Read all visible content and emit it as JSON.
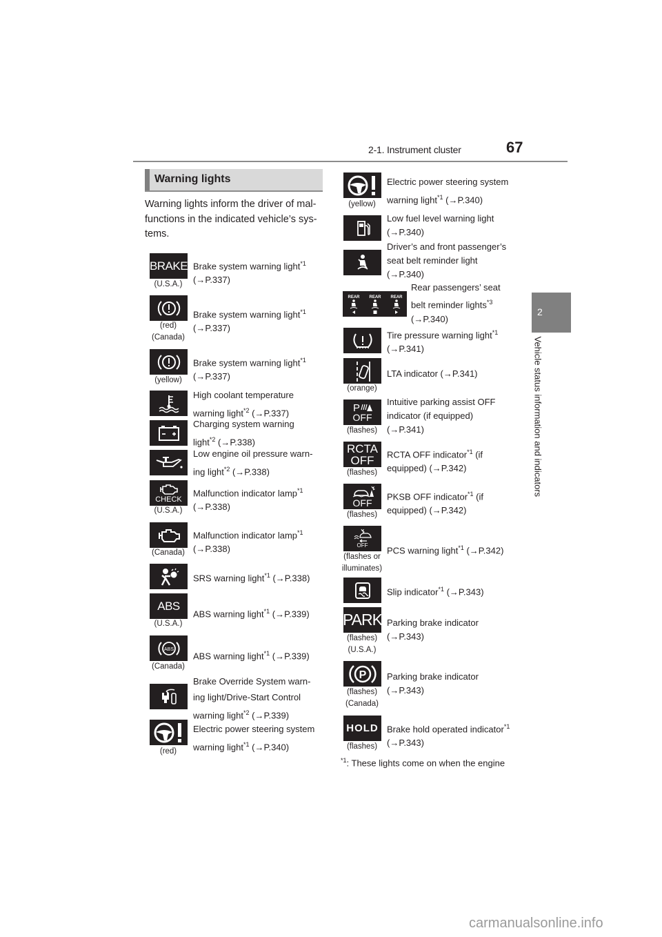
{
  "header": {
    "section": "2-1. Instrument cluster",
    "page_number": "67"
  },
  "side_tab": {
    "chapter_number": "2",
    "chapter_title": "Vehicle status information and indicators"
  },
  "section": {
    "title": "Warning lights",
    "intro_lines": [
      "Warning lights inform the driver of mal-",
      "functions in the indicated vehicle’s sys-",
      "tems."
    ]
  },
  "left_column": [
    {
      "icon": "brake-text-icon",
      "icon_text": "BRAKE",
      "caption": [
        "(U.S.A.)"
      ],
      "lines": [
        "Brake system warning light",
        "(→P.337)"
      ],
      "sup": "*1"
    },
    {
      "icon": "brake-circle-icon",
      "caption": [
        "(red)",
        "(Canada)"
      ],
      "lines": [
        "Brake system warning light",
        "(→P.337)"
      ],
      "sup": "*1"
    },
    {
      "icon": "brake-circle-icon",
      "caption": [
        "(yellow)"
      ],
      "lines": [
        "Brake system warning light",
        "(→P.337)"
      ],
      "sup": "*1"
    },
    {
      "icon": "coolant-temperature-icon",
      "caption": [],
      "lines": [
        "High coolant temperature",
        "warning light",
        " (→P.337)"
      ],
      "sup": "*2"
    },
    {
      "icon": "battery-icon",
      "caption": [],
      "lines": [
        "Charging system warning",
        "light",
        " (→P.338)"
      ],
      "sup": "*2"
    },
    {
      "icon": "oil-can-icon",
      "caption": [],
      "lines": [
        "Low engine oil pressure warn-",
        "ing light",
        " (→P.338)"
      ],
      "sup": "*2"
    },
    {
      "icon": "engine-check-icon",
      "icon_text": "CHECK",
      "caption": [
        "(U.S.A.)"
      ],
      "lines": [
        "Malfunction indicator lamp",
        "(→P.338)"
      ],
      "sup": "*1"
    },
    {
      "icon": "engine-icon",
      "caption": [
        "(Canada)"
      ],
      "lines": [
        "Malfunction indicator lamp",
        "(→P.338)"
      ],
      "sup": "*1"
    },
    {
      "icon": "airbag-icon",
      "caption": [],
      "lines": [
        "SRS warning light",
        " (→P.338)"
      ],
      "sup": "*1"
    },
    {
      "icon": "abs-text-icon",
      "icon_text": "ABS",
      "caption": [
        "(U.S.A.)"
      ],
      "lines": [
        "ABS warning light",
        " (→P.339)"
      ],
      "sup": "*1"
    },
    {
      "icon": "abs-circle-icon",
      "icon_text": "ABS",
      "caption": [
        "(Canada)"
      ],
      "lines": [
        "ABS warning light",
        " (→P.339)"
      ],
      "sup": "*1"
    },
    {
      "icon": "brake-override-icon",
      "caption": [],
      "lines": [
        "Brake Override System warn-",
        "ing light/Drive-Start Control",
        "warning light",
        " (→P.339)"
      ],
      "sup": "*2"
    },
    {
      "icon": "steering-wheel-icon",
      "caption": [
        "(red)"
      ],
      "lines": [
        "Electric power steering system",
        "warning light",
        " (→P.340)"
      ],
      "sup": "*1"
    }
  ],
  "right_column": [
    {
      "icon": "steering-wheel-icon",
      "caption": [
        "(yellow)"
      ],
      "lines": [
        "Electric power steering system",
        "warning light",
        " (→P.340)"
      ],
      "sup": "*1"
    },
    {
      "icon": "fuel-pump-icon",
      "caption": [],
      "lines": [
        "Low fuel level warning light",
        "(→P.340)"
      ],
      "sup": ""
    },
    {
      "icon": "seat-belt-icon",
      "caption": [],
      "lines": [
        "Driver’s and front passenger’s",
        "seat belt reminder light",
        "(→P.340)"
      ],
      "sup": ""
    },
    {
      "icon": "rear-seat-belt-icon",
      "icon_text": "REAR",
      "caption": [],
      "lines": [
        "Rear passengers’ seat",
        "belt reminder lights",
        "(→P.340)"
      ],
      "sup": "*3"
    },
    {
      "icon": "tire-pressure-icon",
      "caption": [],
      "lines": [
        "Tire pressure warning light",
        "(→P.341)"
      ],
      "sup": "*1"
    },
    {
      "icon": "lta-icon",
      "caption": [
        "(orange)"
      ],
      "lines": [
        "LTA indicator (→P.341)"
      ],
      "sup": ""
    },
    {
      "icon": "parking-assist-off-icon",
      "icon_text": "OFF",
      "caption": [
        "(flashes)"
      ],
      "lines": [
        "Intuitive parking assist OFF",
        "indicator (if equipped)",
        "(→P.341)"
      ],
      "sup": ""
    },
    {
      "icon": "rcta-off-icon",
      "icon_text": "RCTA",
      "icon_text2": "OFF",
      "caption": [
        "(flashes)"
      ],
      "lines": [
        "RCTA OFF indicator",
        " (if",
        "equipped) (→P.342)"
      ],
      "sup": "*1"
    },
    {
      "icon": "pksb-off-icon",
      "icon_text": "OFF",
      "caption": [
        "(flashes)"
      ],
      "lines": [
        "PKSB OFF indicator",
        " (if",
        "equipped) (→P.342)"
      ],
      "sup": "*1"
    },
    {
      "icon": "pcs-icon",
      "icon_text": "OFF",
      "caption": [
        "(flashes or",
        "illuminates)"
      ],
      "lines": [
        "PCS warning light",
        " (→P.342)"
      ],
      "sup": "*1"
    },
    {
      "icon": "slip-indicator-icon",
      "caption": [],
      "lines": [
        "Slip indicator",
        " (→P.343)"
      ],
      "sup": "*1"
    },
    {
      "icon": "park-text-icon",
      "icon_text": "PARK",
      "caption": [
        "(flashes)",
        "(U.S.A.)"
      ],
      "lines": [
        "Parking brake indicator",
        "(→P.343)"
      ],
      "sup": ""
    },
    {
      "icon": "parking-brake-circle-icon",
      "icon_text": "P",
      "caption": [
        "(flashes)",
        "(Canada)"
      ],
      "lines": [
        "Parking brake indicator",
        "(→P.343)"
      ],
      "sup": ""
    },
    {
      "icon": "hold-text-icon",
      "icon_text": "HOLD",
      "caption": [
        "(flashes)"
      ],
      "lines": [
        "Brake hold operated indicator",
        "(→P.343)"
      ],
      "sup": "*1"
    }
  ],
  "footnote": {
    "mark": "*1",
    "text": ":  These lights come on when the engine"
  },
  "watermark": "carmanualsonline.info"
}
